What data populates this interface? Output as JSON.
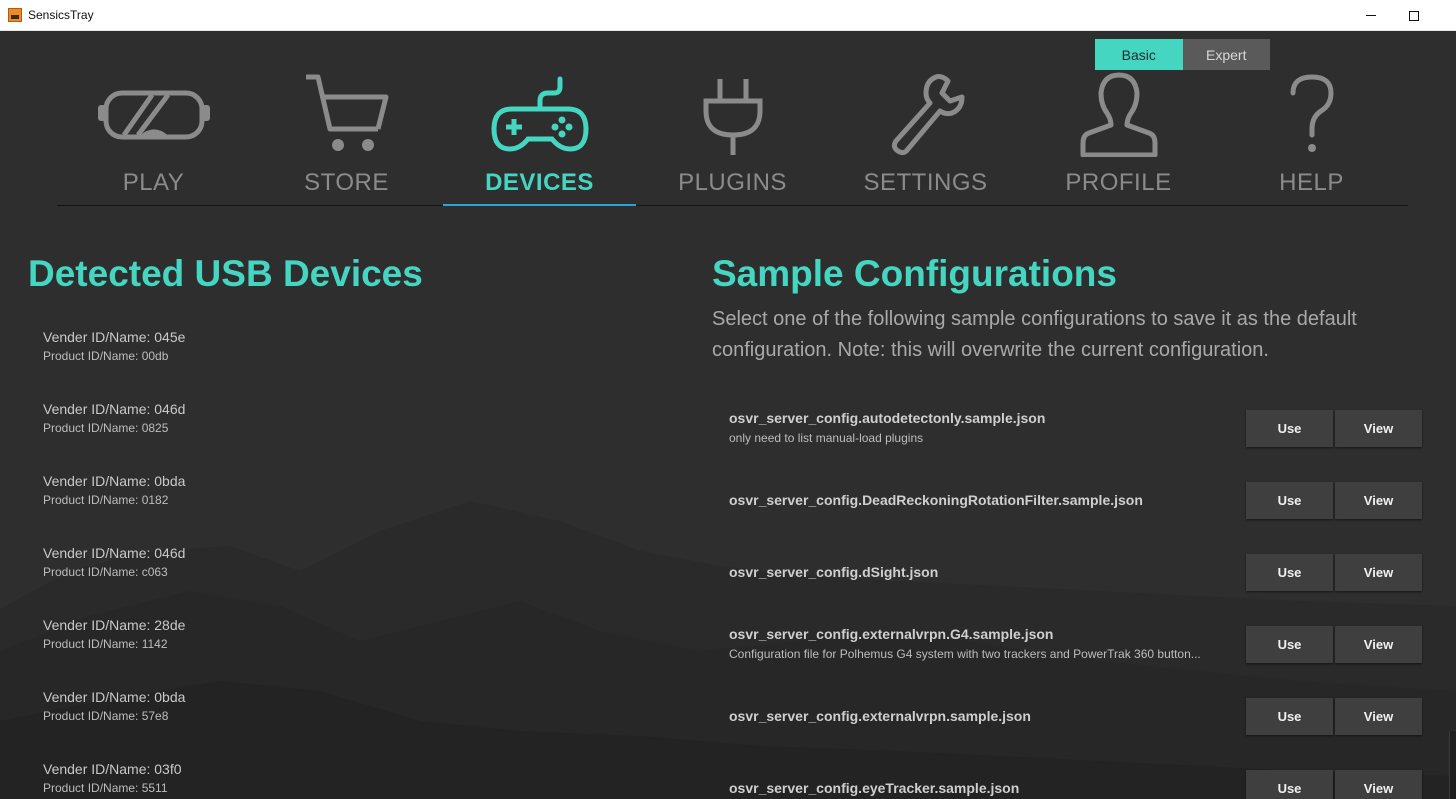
{
  "window": {
    "title": "SensicsTray"
  },
  "mode_toggle": {
    "basic_label": "Basic",
    "expert_label": "Expert",
    "active": "Basic"
  },
  "nav": {
    "active": "DEVICES",
    "items": [
      {
        "label": "PLAY",
        "icon": "vr-headset-icon"
      },
      {
        "label": "STORE",
        "icon": "shopping-cart-icon"
      },
      {
        "label": "DEVICES",
        "icon": "gamepad-icon"
      },
      {
        "label": "PLUGINS",
        "icon": "power-plug-icon"
      },
      {
        "label": "SETTINGS",
        "icon": "wrench-icon"
      },
      {
        "label": "PROFILE",
        "icon": "person-icon"
      },
      {
        "label": "HELP",
        "icon": "question-mark-icon"
      }
    ]
  },
  "usb": {
    "title": "Detected USB Devices",
    "devices": [
      {
        "vendor": "Vender ID/Name: 045e",
        "product": "Product ID/Name: 00db"
      },
      {
        "vendor": "Vender ID/Name: 046d",
        "product": "Product ID/Name: 0825"
      },
      {
        "vendor": "Vender ID/Name: 0bda",
        "product": "Product ID/Name: 0182"
      },
      {
        "vendor": "Vender ID/Name: 046d",
        "product": "Product ID/Name: c063"
      },
      {
        "vendor": "Vender ID/Name: 28de",
        "product": "Product ID/Name: 1142"
      },
      {
        "vendor": "Vender ID/Name: 0bda",
        "product": "Product ID/Name: 57e8"
      },
      {
        "vendor": "Vender ID/Name: 03f0",
        "product": "Product ID/Name: 5511"
      }
    ]
  },
  "samples": {
    "title": "Sample Configurations",
    "description": "Select one of the following sample configurations to save it as the default configuration. Note: this will overwrite the current configuration.",
    "use_label": "Use",
    "view_label": "View",
    "configs": [
      {
        "name": "osvr_server_config.autodetectonly.sample.json",
        "desc": "only need to list manual-load plugins"
      },
      {
        "name": "osvr_server_config.DeadReckoningRotationFilter.sample.json",
        "desc": ""
      },
      {
        "name": "osvr_server_config.dSight.json",
        "desc": ""
      },
      {
        "name": "osvr_server_config.externalvrpn.G4.sample.json",
        "desc": "Configuration file for Polhemus G4 system with two trackers and PowerTrak 360 button..."
      },
      {
        "name": "osvr_server_config.externalvrpn.sample.json",
        "desc": ""
      },
      {
        "name": "osvr_server_config.eyeTracker.sample.json",
        "desc": ""
      }
    ]
  },
  "colors": {
    "accent": "#45d6c2",
    "background": "#2e2e2f",
    "nav_inactive": "#8b8b8b",
    "button_bg": "#3f3f40"
  }
}
